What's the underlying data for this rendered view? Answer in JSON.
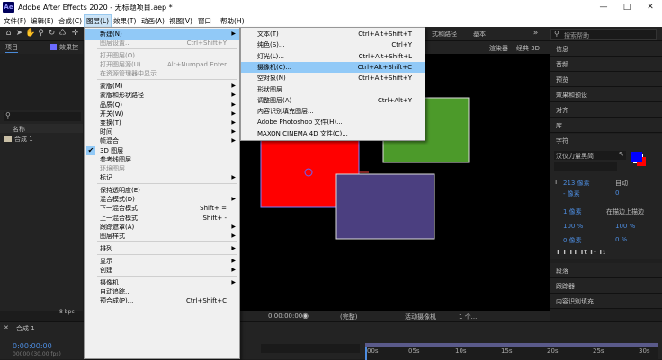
{
  "window": {
    "app_icon": "Ae",
    "title": "Adobe After Effects 2020 - 无标题项目.aep *",
    "minimize_icon": "minimize-icon",
    "maximize_icon": "maximize-icon",
    "close_icon": "close-icon"
  },
  "menubar": [
    "文件(F)",
    "编辑(E)",
    "合成(C)",
    "图层(L)",
    "效果(T)",
    "动画(A)",
    "视图(V)",
    "窗口",
    "帮助(H)"
  ],
  "toolbar": {
    "search_placeholder": "搜索帮助",
    "menu_fragment_1": "式和路径",
    "menu_fragment_2": "基本"
  },
  "project_panel": {
    "tab": "项目",
    "tab2": "效果控",
    "col_name": "名称",
    "item": "合成 1",
    "bpc": "8 bpc"
  },
  "viewer": {
    "renderer": "渲染器",
    "renderer_value": "经典 3D",
    "timecode": "0:00:00:00",
    "quality": "(完整)",
    "camera": "活动摄像机",
    "views": "1 个..."
  },
  "timeline": {
    "tab": "合成 1",
    "timecode": "0:00:00:00",
    "fps": "00000 (30.00 fps)",
    "ruler": [
      "00s",
      "05s",
      "10s",
      "15s",
      "20s",
      "25s",
      "30s"
    ]
  },
  "right_panel": {
    "sections": [
      "信息",
      "音频",
      "预览",
      "效果和预设",
      "对齐",
      "库"
    ],
    "char_title": "字符",
    "font_name": "汉仪力量黑简",
    "font_size": "213 像素",
    "auto_label": "自动",
    "tracking_label": "- 像素",
    "kerning_label": "0",
    "stroke_label": "1 像素",
    "stroke_mode": "在描边上描边",
    "vscale": "100 %",
    "hscale": "100 %",
    "baseline": "0 像素",
    "tsume": "0 %",
    "fill_color": "#0000ff",
    "stroke_color": "#ff0000",
    "bottom_sections": [
      "段落",
      "跟踪器",
      "内容识别填充"
    ]
  },
  "layer_menu": {
    "items": [
      {
        "label": "新建(N)",
        "shortcut": "",
        "arrow": true,
        "highlight": true,
        "disabled": false
      },
      {
        "label": "图层设置...",
        "shortcut": "Ctrl+Shift+Y",
        "arrow": false,
        "disabled": true
      },
      {
        "sep": true
      },
      {
        "label": "打开图层(O)",
        "shortcut": "",
        "arrow": false,
        "disabled": true
      },
      {
        "label": "打开图层源(U)",
        "shortcut": "Alt+Numpad Enter",
        "arrow": false,
        "disabled": true
      },
      {
        "label": "在资源管理器中显示",
        "shortcut": "",
        "arrow": false,
        "disabled": true
      },
      {
        "sep": true
      },
      {
        "label": "蒙版(M)",
        "shortcut": "",
        "arrow": true
      },
      {
        "label": "蒙版和形状路径",
        "shortcut": "",
        "arrow": true
      },
      {
        "label": "品质(Q)",
        "shortcut": "",
        "arrow": true
      },
      {
        "label": "开关(W)",
        "shortcut": "",
        "arrow": true
      },
      {
        "label": "变换(T)",
        "shortcut": "",
        "arrow": true
      },
      {
        "label": "时间",
        "shortcut": "",
        "arrow": true
      },
      {
        "label": "帧混合",
        "shortcut": "",
        "arrow": true
      },
      {
        "label": "3D 图层",
        "shortcut": "",
        "arrow": false,
        "checked": true
      },
      {
        "label": "参考线图层",
        "shortcut": "",
        "arrow": false
      },
      {
        "label": "环境图层",
        "shortcut": "",
        "arrow": false,
        "disabled": true
      },
      {
        "label": "标记",
        "shortcut": "",
        "arrow": true
      },
      {
        "sep": true
      },
      {
        "label": "保持透明度(E)",
        "shortcut": "",
        "arrow": false
      },
      {
        "label": "混合模式(D)",
        "shortcut": "",
        "arrow": true
      },
      {
        "label": "下一混合模式",
        "shortcut": "Shift+ =",
        "arrow": false
      },
      {
        "label": "上一混合模式",
        "shortcut": "Shift+ -",
        "arrow": false
      },
      {
        "label": "跟踪遮罩(A)",
        "shortcut": "",
        "arrow": true
      },
      {
        "label": "图层样式",
        "shortcut": "",
        "arrow": true
      },
      {
        "sep": true
      },
      {
        "label": "排列",
        "shortcut": "",
        "arrow": true
      },
      {
        "sep": true
      },
      {
        "label": "显示",
        "shortcut": "",
        "arrow": true
      },
      {
        "label": "创建",
        "shortcut": "",
        "arrow": true
      },
      {
        "sep": true
      },
      {
        "label": "摄像机",
        "shortcut": "",
        "arrow": true
      },
      {
        "label": "自动追踪...",
        "shortcut": "",
        "arrow": false
      },
      {
        "label": "预合成(P)...",
        "shortcut": "Ctrl+Shift+C",
        "arrow": false
      }
    ]
  },
  "new_submenu": {
    "items": [
      {
        "label": "文本(T)",
        "shortcut": "Ctrl+Alt+Shift+T"
      },
      {
        "label": "纯色(S)...",
        "shortcut": "Ctrl+Y"
      },
      {
        "label": "灯光(L)...",
        "shortcut": "Ctrl+Alt+Shift+L"
      },
      {
        "label": "摄像机(C)...",
        "shortcut": "Ctrl+Alt+Shift+C",
        "highlight": true
      },
      {
        "label": "空对象(N)",
        "shortcut": "Ctrl+Alt+Shift+Y"
      },
      {
        "label": "形状图层",
        "shortcut": ""
      },
      {
        "label": "调整图层(A)",
        "shortcut": "Ctrl+Alt+Y"
      },
      {
        "label": "内容识别填充图层...",
        "shortcut": ""
      },
      {
        "label": "Adobe Photoshop 文件(H)...",
        "shortcut": ""
      },
      {
        "label": "MAXON CINEMA 4D 文件(C)...",
        "shortcut": ""
      }
    ]
  },
  "colors": {
    "red_solid": "#ff0000",
    "green_solid": "#4c9a2a",
    "purple_solid": "#4b3f80",
    "menu_highlight": "#91c9f7"
  }
}
